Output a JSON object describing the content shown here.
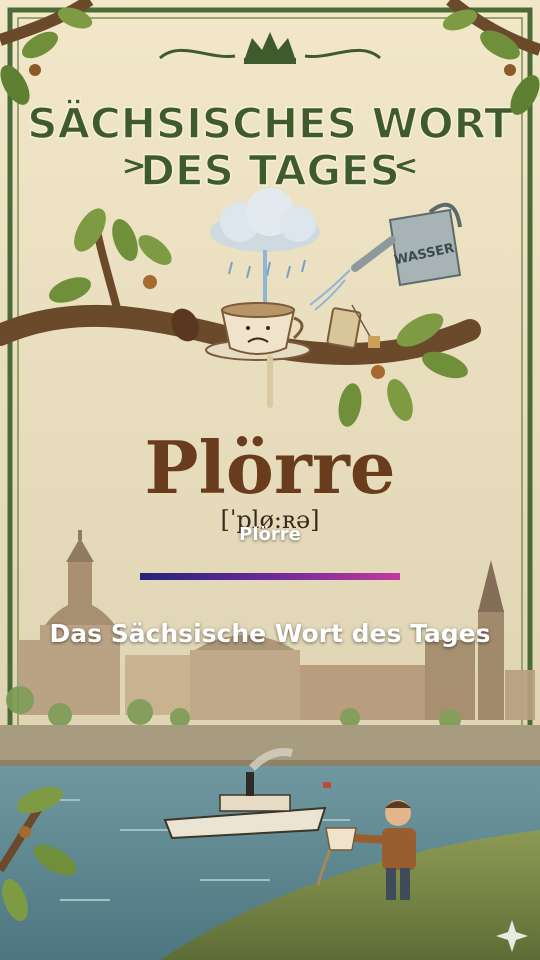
{
  "poster": {
    "title_line1": "SÄCHSISCHES WORT",
    "title_line2": "DES TAGES",
    "word": "Plörre",
    "pronunciation": "[ˈplø:ʀə]",
    "can_label": "WASSER"
  },
  "overlay": {
    "word": "Plörre",
    "title": "Das Sächsische Wort des Tages"
  },
  "colors": {
    "title_green": "#3f5a2b",
    "word_brown": "#6a3c1e",
    "parchment": "#efe4c4",
    "river": "#5f8a92",
    "bar_start": "#24237c",
    "bar_end": "#c23a9f"
  },
  "icons": [
    "crown-icon",
    "cloud-icon",
    "coffee-cup-icon",
    "watering-can-icon",
    "tea-bag-icon",
    "coffee-bean-icon",
    "steamboat-icon",
    "sparkle-icon"
  ]
}
